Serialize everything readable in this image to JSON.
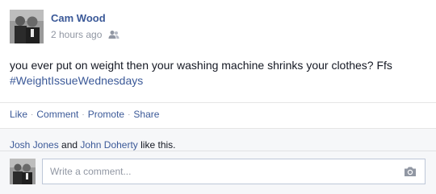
{
  "post": {
    "author": "Cam Wood",
    "timestamp": "2 hours ago",
    "audience_icon": "friends-icon",
    "text_line1": "you ever put on weight then your washing machine shrinks your clothes? Ffs",
    "hashtag": "#WeightIssueWednesdays"
  },
  "actions": {
    "like": "Like",
    "comment": "Comment",
    "promote": "Promote",
    "share": "Share",
    "separator": "·"
  },
  "likes": {
    "person1": "Josh Jones",
    "conjunction": "and",
    "person2": "John Doherty",
    "suffix": "like this."
  },
  "comment": {
    "placeholder": "Write a comment...",
    "attach_icon": "camera-icon"
  },
  "colors": {
    "link": "#3b5998",
    "muted": "#9197a3",
    "text": "#141823",
    "footer_bg": "#f6f7f9"
  }
}
